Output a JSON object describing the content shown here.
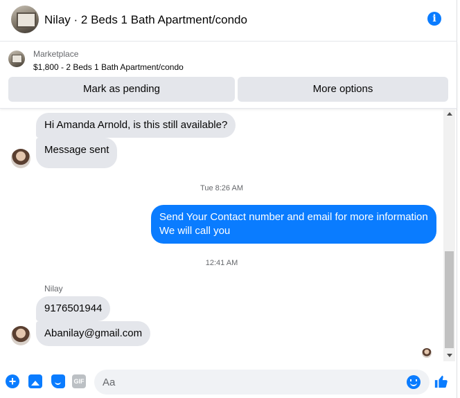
{
  "header": {
    "title": "Nilay · 2 Beds 1 Bath Apartment/condo",
    "info_icon": "i"
  },
  "marketplace": {
    "label": "Marketplace",
    "listing": "$1,800 - 2 Beds 1 Bath Apartment/condo",
    "buttons": {
      "mark_pending": "Mark as pending",
      "more_options": "More options"
    }
  },
  "messages": {
    "msg1": "Hi Amanda Arnold, is this still available?",
    "msg2": "Message sent",
    "time1": "Tue 8:26 AM",
    "out_line1": "Send Your Contact number and email for more information",
    "out_line2": "We will call you",
    "time2": "12:41 AM",
    "sender": "Nilay",
    "msg3": "9176501944",
    "msg4": "Abanilay@gmail.com"
  },
  "composer": {
    "placeholder": "Aa",
    "gif_label": "GIF"
  },
  "colors": {
    "accent": "#0a7cff",
    "bubble_gray": "#e4e6eb"
  }
}
